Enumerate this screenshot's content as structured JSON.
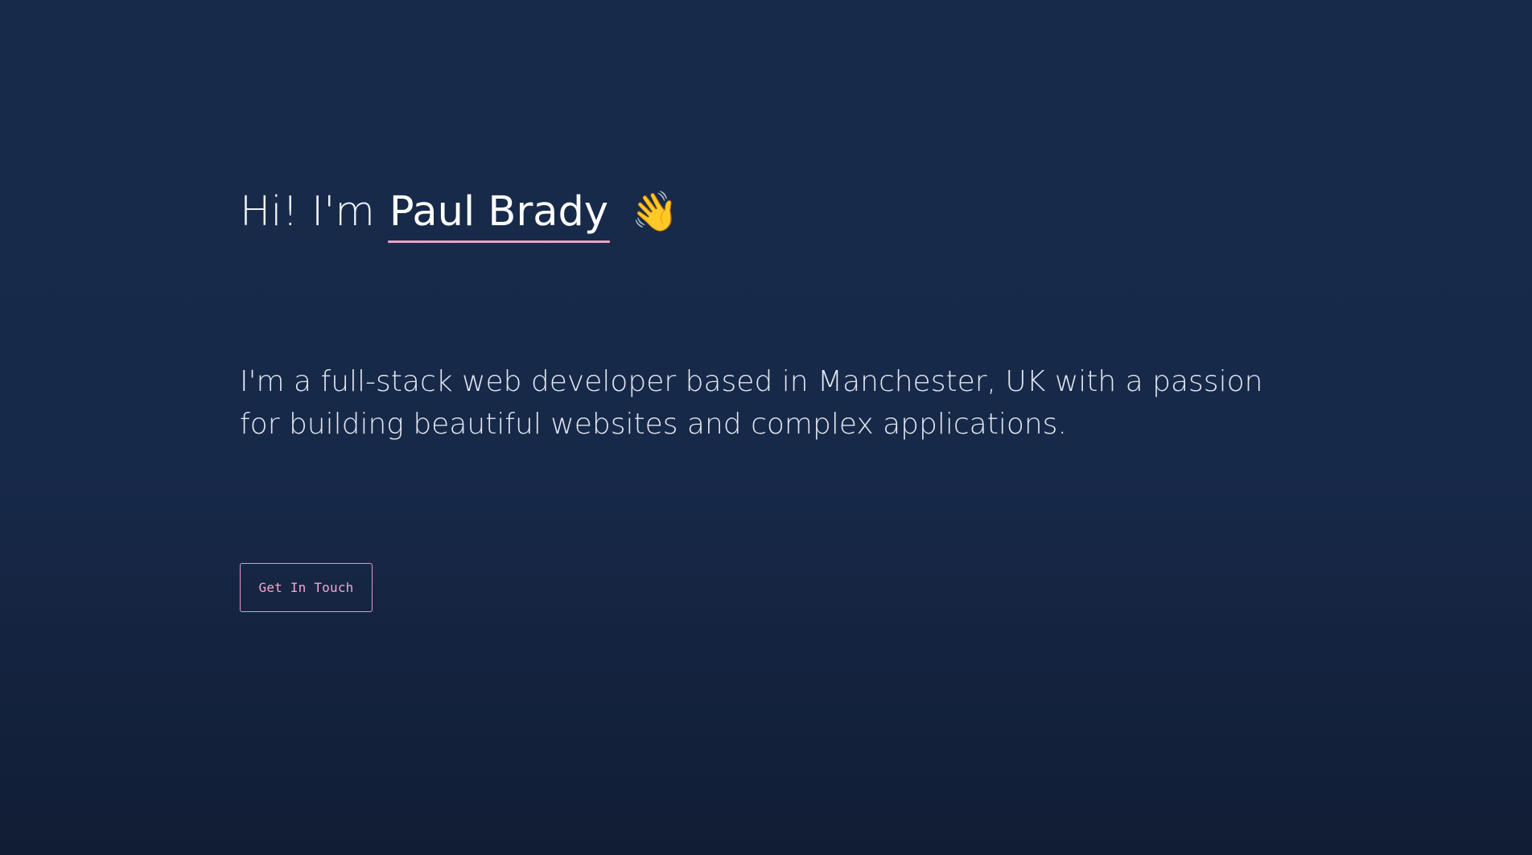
{
  "hero": {
    "greeting_prefix": "Hi! I'm",
    "name": "Paul Brady",
    "wave_emoji": "👋",
    "intro": "I'm a full-stack web developer based in Manchester, UK with a passion for building beautiful websites and complex applications.",
    "cta_label": "Get In Touch"
  },
  "colors": {
    "background_top": "#172a4a",
    "background_bottom": "#111d34",
    "text": "#eef1f6",
    "accent": "#f0a0c8"
  }
}
